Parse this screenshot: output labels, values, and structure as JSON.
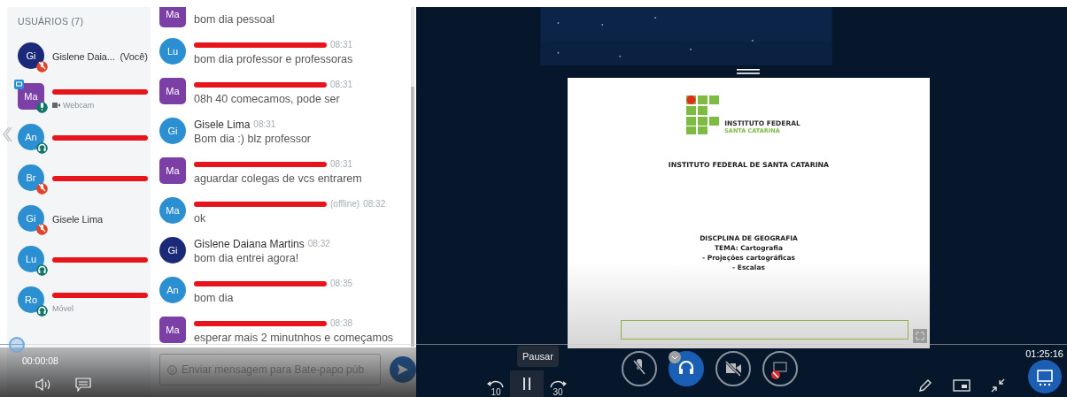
{
  "users_panel": {
    "title": "USUÁRIOS (7)",
    "users": [
      {
        "initials": "Gi",
        "color": "#1b2a78",
        "moderator": false,
        "presenter": false,
        "redacted": false,
        "name": "Gislene Daia...",
        "suffix": "(Você)",
        "muted": true,
        "listen_only": false
      },
      {
        "initials": "Ma",
        "color": "#7b3fa6",
        "moderator": true,
        "presenter": true,
        "redacted": true,
        "subtitle": "Webcam",
        "camera": true,
        "muted": false,
        "listen_only": false
      },
      {
        "initials": "An",
        "color": "#2b8fd2",
        "moderator": false,
        "presenter": false,
        "redacted": true,
        "muted": false,
        "listen_only": true
      },
      {
        "initials": "Br",
        "color": "#2b8fd2",
        "moderator": false,
        "presenter": false,
        "redacted": true,
        "muted": true,
        "listen_only": false
      },
      {
        "initials": "Gi",
        "color": "#2b8fd2",
        "moderator": false,
        "presenter": false,
        "redacted": false,
        "name": "Gisele Lima",
        "muted": true,
        "listen_only": false
      },
      {
        "initials": "Lu",
        "color": "#2b8fd2",
        "moderator": false,
        "presenter": false,
        "redacted": true,
        "muted": false,
        "listen_only": true
      },
      {
        "initials": "Ro",
        "color": "#2b8fd2",
        "moderator": false,
        "presenter": false,
        "redacted": true,
        "subtitle": "Móvel",
        "camera": false,
        "muted": false,
        "listen_only": true
      }
    ]
  },
  "chat": {
    "messages": [
      {
        "initials": "Ma",
        "color": "#7b3fa6",
        "moderator": true,
        "text": "bom dia pessoal"
      },
      {
        "initials": "Lu",
        "color": "#2b8fd2",
        "moderator": false,
        "redacted": true,
        "time": "08:31",
        "text": "bom dia professor e professoras"
      },
      {
        "initials": "Ma",
        "color": "#7b3fa6",
        "moderator": true,
        "redacted": true,
        "time": "08:31",
        "text": "08h 40 comecamos, pode ser"
      },
      {
        "initials": "Gi",
        "color": "#2b8fd2",
        "moderator": false,
        "redacted": false,
        "sender": "Gisele Lima",
        "time": "08:31",
        "text": "Bom dia :) blz professor"
      },
      {
        "initials": "Ma",
        "color": "#7b3fa6",
        "moderator": true,
        "redacted": true,
        "time": "08:31",
        "text": "aguardar colegas de vcs entrarem"
      },
      {
        "initials": "Ma",
        "color": "#2b8fd2",
        "moderator": false,
        "redacted": true,
        "offline_label": "(offline)",
        "time": "08:32",
        "text": "ok"
      },
      {
        "initials": "Gi",
        "color": "#1b2a78",
        "moderator": false,
        "redacted": false,
        "sender": "Gislene Daiana Martins",
        "time": "08:32",
        "text": "bom dia entrei agora!"
      },
      {
        "initials": "An",
        "color": "#2b8fd2",
        "moderator": false,
        "redacted": true,
        "time": "08:35",
        "text": "bom dia"
      },
      {
        "initials": "Ma",
        "color": "#7b3fa6",
        "moderator": true,
        "redacted": true,
        "time": "08:38",
        "text": "esperar mais 2 minutnhos e começamos"
      }
    ],
    "input": {
      "placeholder": "Enviar mensagem para Bate-papo púb"
    }
  },
  "playback": {
    "elapsed": "00:00:08"
  },
  "slide": {
    "logo_line_1": "INSTITUTO FEDERAL",
    "logo_line_2": "SANTA CATARINA",
    "heading": "INSTITUTO FEDERAL DE SANTA CATARINA",
    "lines": [
      "DISCPLINA DE GEOGRAFIA",
      "TEMA: Cartografia",
      "- Projeções cartográficas",
      "- Escalas"
    ]
  },
  "player_controls": {
    "tooltip": "Pausar",
    "rewind_label": "10",
    "forward_label": "30",
    "media_buttons": [
      {
        "kind": "mic",
        "on": false
      },
      {
        "kind": "audio",
        "on": true
      },
      {
        "kind": "camera",
        "on": false
      },
      {
        "kind": "screen",
        "on": false
      }
    ],
    "session_time": "01:25:16"
  }
}
